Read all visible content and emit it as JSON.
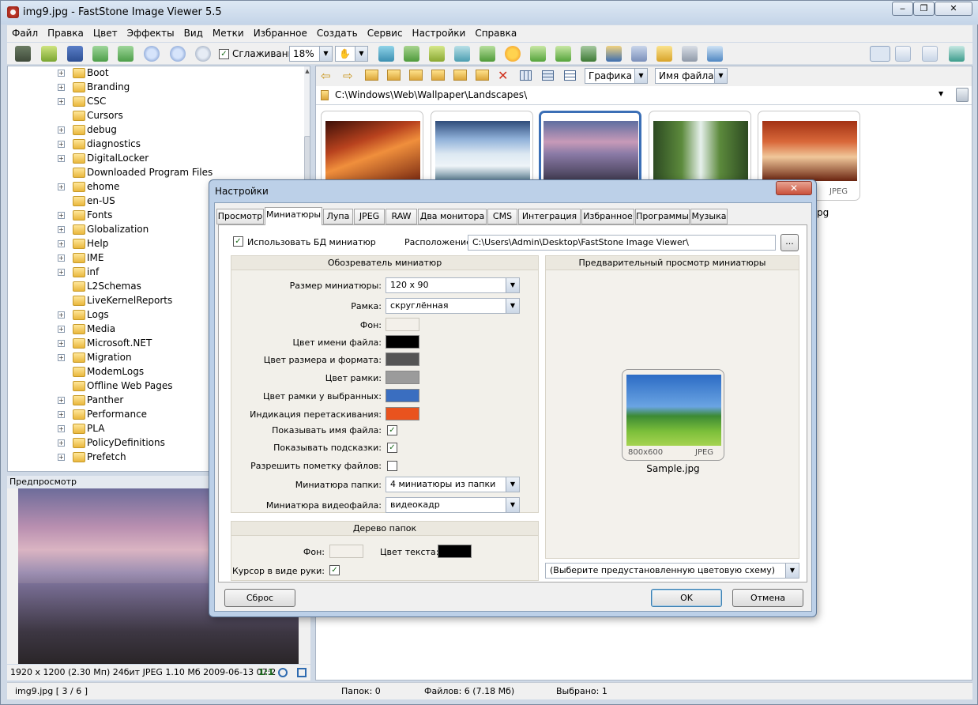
{
  "window": {
    "title": "img9.jpg  -  FastStone Image Viewer 5.5"
  },
  "menu": [
    "Файл",
    "Правка",
    "Цвет",
    "Эффекты",
    "Вид",
    "Метки",
    "Избранное",
    "Создать",
    "Сервис",
    "Настройки",
    "Справка"
  ],
  "toolbar": {
    "smoothing_label": "Сглаживание",
    "smoothing_checked": true,
    "zoom": "18%"
  },
  "tree": {
    "folders": [
      "Boot",
      "Branding",
      "CSC",
      "Cursors",
      "debug",
      "diagnostics",
      "DigitalLocker",
      "Downloaded Program Files",
      "ehome",
      "en-US",
      "Fonts",
      "Globalization",
      "Help",
      "IME",
      "inf",
      "L2Schemas",
      "LiveKernelReports",
      "Logs",
      "Media",
      "Microsoft.NET",
      "Migration",
      "ModemLogs",
      "Offline Web Pages",
      "Panther",
      "Performance",
      "PLA",
      "PolicyDefinitions",
      "Prefetch"
    ]
  },
  "preview": {
    "header": "Предпросмотр",
    "info": "1920 x 1200 (2.30 Мп)  24бит  JPEG  1.10 Мб  2009-06-13 07:2",
    "zoom_label": "1:1"
  },
  "browser": {
    "view_mode": "Графика",
    "sort": "Имя файла",
    "path": "C:\\Windows\\Web\\Wallpaper\\Landscapes\\",
    "partial_format_label": "JPEG",
    "partial_name": "pg"
  },
  "status": {
    "file": "img9.jpg [ 3 / 6 ]",
    "folders": "Папок: 0",
    "files": "Файлов: 6 (7.18 Мб)",
    "selected": "Выбрано: 1"
  },
  "dialog": {
    "title": "Настройки",
    "tabs": [
      "Просмотр",
      "Миниатюры",
      "Лупа",
      "JPEG",
      "RAW",
      "Два монитора",
      "CMS",
      "Интеграция",
      "Избранное",
      "Программы",
      "Музыка"
    ],
    "active_tab": "Миниатюры",
    "use_db_label": "Использовать БД миниатюр",
    "use_db_checked": true,
    "location_label": "Расположение:",
    "location_value": "C:\\Users\\Admin\\Desktop\\FastStone Image Viewer\\",
    "browse_label": "...",
    "browser_group": "Обозреватель миниатюр",
    "size_label": "Размер миниатюры:",
    "size_value": "120 x 90",
    "frame_label": "Рамка:",
    "frame_value": "скруглённая",
    "bg_label": "Фон:",
    "bg_color": "#f3f0ea",
    "name_color_label": "Цвет имени файла:",
    "name_color": "#000000",
    "size_color_label": "Цвет размера и формата:",
    "size_color": "#555555",
    "frame_color_label": "Цвет рамки:",
    "frame_color": "#9b9b9b",
    "sel_frame_color_label": "Цвет рамки у выбранных:",
    "sel_frame_color": "#3a6ec0",
    "drag_color_label": "Индикация перетаскивания:",
    "drag_color": "#e9531e",
    "show_name_label": "Показывать имя файла:",
    "show_name_checked": true,
    "show_hints_label": "Показывать подсказки:",
    "show_hints_checked": true,
    "allow_mark_label": "Разрешить пометку файлов:",
    "allow_mark_checked": false,
    "folder_thumb_label": "Миниатюра папки:",
    "folder_thumb_value": "4 миниатюры из папки",
    "video_thumb_label": "Миниатюра видеофайла:",
    "video_thumb_value": "видеокадр",
    "tree_group": "Дерево папок",
    "tree_bg_label": "Фон:",
    "tree_bg_color": "#f3f0ea",
    "tree_text_color_label": "Цвет текста:",
    "tree_text_color": "#000000",
    "hand_cursor_label": "Курсор в виде руки:",
    "hand_cursor_checked": true,
    "preview_group": "Предварительный просмотр миниатюры",
    "sample_dims": "800x600",
    "sample_format": "JPEG",
    "sample_name": "Sample.jpg",
    "scheme_value": "(Выберите предустановленную цветовую схему)",
    "reset_label": "Сброс",
    "ok_label": "OK",
    "cancel_label": "Отмена"
  }
}
